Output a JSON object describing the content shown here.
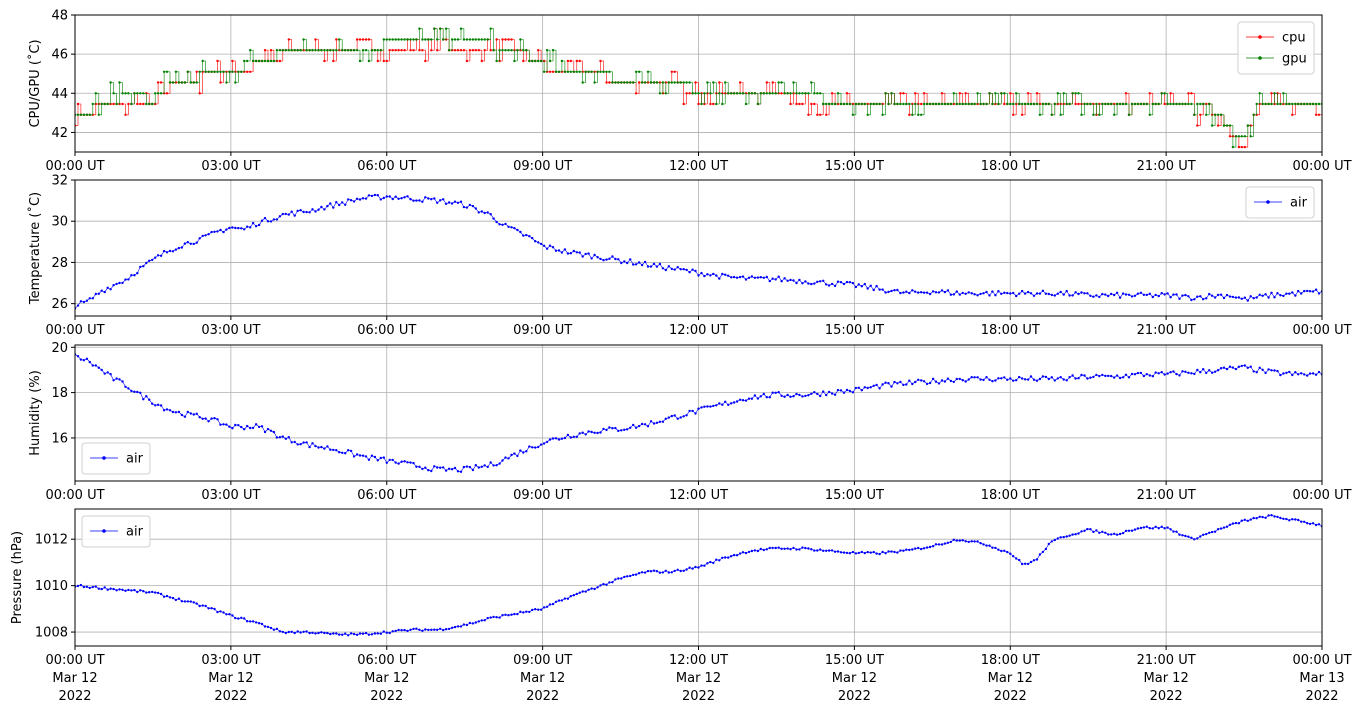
{
  "colors": {
    "cpu": "#ff0000",
    "gpu": "#008000",
    "air": "#0000ff",
    "grid": "#b0b0b0"
  },
  "x_ticks": [
    {
      "label": "00:00 UT",
      "date": "Mar 12",
      "year": "2022"
    },
    {
      "label": "03:00 UT",
      "date": "Mar 12",
      "year": "2022"
    },
    {
      "label": "06:00 UT",
      "date": "Mar 12",
      "year": "2022"
    },
    {
      "label": "09:00 UT",
      "date": "Mar 12",
      "year": "2022"
    },
    {
      "label": "12:00 UT",
      "date": "Mar 12",
      "year": "2022"
    },
    {
      "label": "15:00 UT",
      "date": "Mar 12",
      "year": "2022"
    },
    {
      "label": "18:00 UT",
      "date": "Mar 12",
      "year": "2022"
    },
    {
      "label": "21:00 UT",
      "date": "Mar 12",
      "year": "2022"
    },
    {
      "label": "00:00 UT",
      "date": "Mar 13",
      "year": "2022"
    }
  ],
  "chart_data": [
    {
      "type": "line",
      "ylabel": "CPU/GPU (˚C)",
      "ylim": [
        41,
        48
      ],
      "yticks": [
        42,
        44,
        46,
        48
      ],
      "xlim_hours": [
        0,
        24
      ],
      "grid": true,
      "legend": "upper right",
      "series": [
        {
          "name": "cpu",
          "color_key": "cpu",
          "x": [
            0,
            0.25,
            0.5,
            0.75,
            1,
            1.25,
            1.5,
            1.75,
            2,
            2.25,
            2.5,
            2.75,
            3,
            3.25,
            3.5,
            3.75,
            4,
            4.5,
            5,
            5.5,
            6,
            6.5,
            7,
            7.5,
            8,
            8.5,
            9,
            9.5,
            10,
            10.5,
            11,
            11.5,
            12,
            12.5,
            13,
            13.5,
            14,
            14.5,
            15,
            15.5,
            16,
            16.5,
            17,
            17.5,
            18,
            18.5,
            19,
            19.5,
            20,
            20.5,
            21,
            21.5,
            22,
            22.25,
            22.5,
            22.75,
            23,
            23.5,
            24
          ],
          "values": [
            42.9,
            43.0,
            43.4,
            43.5,
            43.7,
            43.6,
            43.5,
            44.2,
            44.5,
            44.4,
            45.0,
            45.0,
            45.1,
            45.2,
            45.5,
            45.6,
            46.0,
            46.1,
            46.2,
            46.3,
            46.3,
            46.4,
            46.5,
            46.4,
            46.3,
            46.1,
            45.4,
            45.0,
            45.0,
            44.6,
            44.4,
            44.3,
            44.2,
            44.0,
            43.9,
            43.8,
            43.7,
            43.6,
            43.4,
            43.4,
            43.3,
            43.3,
            43.3,
            43.3,
            43.2,
            43.2,
            43.2,
            43.2,
            43.2,
            43.2,
            43.2,
            43.2,
            43.0,
            41.9,
            42.0,
            43.2,
            43.3,
            43.3,
            43.2
          ]
        },
        {
          "name": "gpu",
          "color_key": "gpu",
          "x": [
            0,
            0.25,
            0.5,
            0.75,
            1,
            1.25,
            1.5,
            1.75,
            2,
            2.25,
            2.5,
            2.75,
            3,
            3.25,
            3.5,
            3.75,
            4,
            4.5,
            5,
            5.5,
            6,
            6.5,
            7,
            7.5,
            8,
            8.5,
            9,
            9.5,
            10,
            10.5,
            11,
            11.5,
            12,
            12.5,
            13,
            13.5,
            14,
            14.5,
            15,
            15.5,
            16,
            16.5,
            17,
            17.5,
            18,
            18.5,
            19,
            19.5,
            20,
            20.5,
            21,
            21.5,
            22,
            22.25,
            22.5,
            22.75,
            23,
            23.5,
            24
          ],
          "values": [
            43.0,
            43.2,
            43.6,
            43.8,
            43.9,
            43.8,
            43.6,
            44.5,
            44.6,
            44.6,
            45.1,
            45.1,
            45.2,
            45.4,
            45.6,
            45.8,
            46.1,
            46.2,
            46.3,
            46.4,
            46.5,
            46.6,
            46.6,
            46.6,
            46.5,
            46.2,
            45.6,
            45.1,
            45.1,
            44.7,
            44.5,
            44.5,
            44.2,
            44.0,
            44.0,
            43.9,
            43.8,
            43.7,
            43.5,
            43.5,
            43.4,
            43.3,
            43.4,
            43.4,
            43.3,
            43.3,
            43.3,
            43.3,
            43.3,
            43.3,
            43.3,
            43.3,
            43.1,
            41.7,
            41.8,
            43.3,
            43.4,
            43.4,
            43.3
          ]
        }
      ]
    },
    {
      "type": "line",
      "ylabel": "Temperature (˚C)",
      "ylim": [
        25.4,
        32
      ],
      "yticks": [
        26,
        28,
        30,
        32
      ],
      "xlim_hours": [
        0,
        24
      ],
      "grid": true,
      "legend": "upper right",
      "series": [
        {
          "name": "air",
          "color_key": "air",
          "x": [
            0,
            0.25,
            0.5,
            0.75,
            1,
            1.25,
            1.5,
            1.75,
            2,
            2.25,
            2.5,
            2.75,
            3,
            3.25,
            3.5,
            3.75,
            4,
            4.5,
            5,
            5.5,
            6,
            6.5,
            7,
            7.5,
            8,
            8.25,
            8.5,
            8.75,
            9,
            9.5,
            10,
            10.5,
            11,
            11.5,
            12,
            12.5,
            13,
            13.5,
            14,
            14.5,
            15,
            15.5,
            16,
            16.5,
            17,
            17.5,
            18,
            18.5,
            19,
            19.5,
            20,
            20.5,
            21,
            21.5,
            22,
            22.25,
            22.5,
            22.75,
            23,
            23.5,
            24
          ],
          "values": [
            25.9,
            26.1,
            26.6,
            26.9,
            27.2,
            27.7,
            28.1,
            28.5,
            28.8,
            29.0,
            29.2,
            29.5,
            29.7,
            29.6,
            29.9,
            30.1,
            30.3,
            30.5,
            30.8,
            31.1,
            31.2,
            31.1,
            31.0,
            30.8,
            30.3,
            29.8,
            29.5,
            29.2,
            28.8,
            28.5,
            28.3,
            28.1,
            27.9,
            27.7,
            27.5,
            27.3,
            27.2,
            27.2,
            27.1,
            27.0,
            26.9,
            26.7,
            26.5,
            26.6,
            26.5,
            26.5,
            26.5,
            26.5,
            26.5,
            26.4,
            26.4,
            26.4,
            26.4,
            26.3,
            26.4,
            26.4,
            26.2,
            26.3,
            26.4,
            26.5,
            26.6
          ]
        }
      ]
    },
    {
      "type": "line",
      "ylabel": "Humidity (%)",
      "ylim": [
        14.1,
        20.1
      ],
      "yticks": [
        16,
        18,
        20
      ],
      "xlim_hours": [
        0,
        24
      ],
      "grid": true,
      "legend": "lower left",
      "series": [
        {
          "name": "air",
          "color_key": "air",
          "x": [
            0,
            0.25,
            0.5,
            0.75,
            1,
            1.25,
            1.5,
            1.75,
            2,
            2.25,
            2.5,
            2.75,
            3,
            3.25,
            3.5,
            3.75,
            4,
            4.5,
            5,
            5.5,
            6,
            6.5,
            7,
            7.5,
            8,
            8.5,
            9,
            9.5,
            10,
            10.5,
            11,
            11.5,
            12,
            12.5,
            13,
            13.5,
            14,
            14.5,
            15,
            15.5,
            16,
            16.5,
            17,
            17.5,
            18,
            18.5,
            19,
            19.5,
            20,
            20.5,
            21,
            21.5,
            22,
            22.5,
            23,
            23.5,
            24
          ],
          "values": [
            19.6,
            19.4,
            19.0,
            18.6,
            18.3,
            17.9,
            17.6,
            17.3,
            17.1,
            17.0,
            16.9,
            16.7,
            16.5,
            16.5,
            16.5,
            16.3,
            16.0,
            15.7,
            15.5,
            15.2,
            15.0,
            14.8,
            14.6,
            14.6,
            14.8,
            15.3,
            15.8,
            16.1,
            16.3,
            16.4,
            16.6,
            16.9,
            17.2,
            17.5,
            17.8,
            17.9,
            17.9,
            18.0,
            18.1,
            18.3,
            18.4,
            18.5,
            18.6,
            18.6,
            18.6,
            18.6,
            18.6,
            18.7,
            18.7,
            18.8,
            18.8,
            18.9,
            19.0,
            19.1,
            18.9,
            18.8,
            18.8
          ]
        }
      ]
    },
    {
      "type": "line",
      "ylabel": "Pressure (hPa)",
      "ylim": [
        1007.4,
        1013.3
      ],
      "yticks": [
        1008,
        1010,
        1012
      ],
      "xlim_hours": [
        0,
        24
      ],
      "grid": true,
      "legend": "upper left",
      "series": [
        {
          "name": "air",
          "color_key": "air",
          "x": [
            0,
            0.5,
            1,
            1.5,
            2,
            2.5,
            3,
            3.5,
            4,
            4.5,
            5,
            5.5,
            6,
            6.5,
            7,
            7.5,
            8,
            8.5,
            9,
            9.5,
            10,
            10.5,
            11,
            11.5,
            12,
            12.5,
            13,
            13.5,
            14,
            14.5,
            15,
            15.5,
            16,
            16.5,
            17,
            17.5,
            18,
            18.25,
            18.5,
            18.75,
            19,
            19.5,
            20,
            20.5,
            21,
            21.5,
            22,
            22.5,
            23,
            23.5,
            24
          ],
          "values": [
            1010.0,
            1009.9,
            1009.8,
            1009.7,
            1009.4,
            1009.1,
            1008.7,
            1008.4,
            1008.0,
            1008.0,
            1007.9,
            1007.9,
            1008.0,
            1008.1,
            1008.1,
            1008.3,
            1008.6,
            1008.8,
            1009.0,
            1009.5,
            1009.9,
            1010.3,
            1010.6,
            1010.6,
            1010.8,
            1011.2,
            1011.5,
            1011.6,
            1011.6,
            1011.5,
            1011.4,
            1011.4,
            1011.5,
            1011.7,
            1012.0,
            1011.8,
            1011.4,
            1010.9,
            1011.1,
            1011.8,
            1012.1,
            1012.4,
            1012.2,
            1012.5,
            1012.5,
            1012.0,
            1012.4,
            1012.8,
            1013.0,
            1012.8,
            1012.6
          ]
        }
      ]
    }
  ]
}
